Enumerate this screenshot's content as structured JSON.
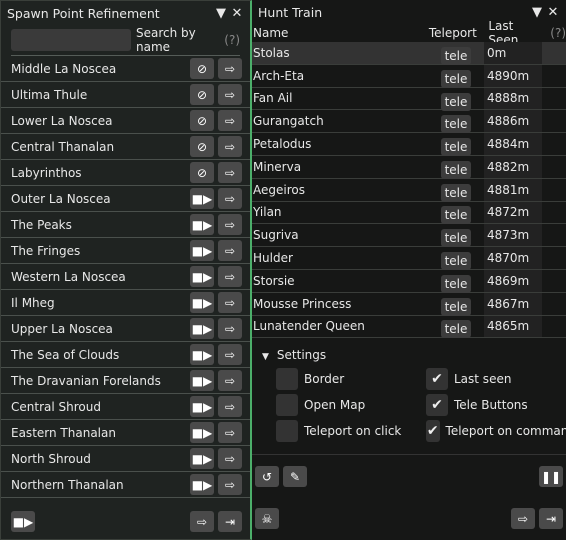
{
  "spawn": {
    "title": "Spawn Point Refinement",
    "search_placeholder": "",
    "search_label": "Search by name",
    "help": "(?)",
    "zones": [
      {
        "name": "Middle La Noscea",
        "disabled": true
      },
      {
        "name": "Ultima Thule",
        "disabled": true
      },
      {
        "name": "Lower La Noscea",
        "disabled": true
      },
      {
        "name": "Central Thanalan",
        "disabled": true
      },
      {
        "name": "Labyrinthos",
        "disabled": true
      },
      {
        "name": "Outer La Noscea",
        "disabled": false
      },
      {
        "name": "The Peaks",
        "disabled": false
      },
      {
        "name": "The Fringes",
        "disabled": false
      },
      {
        "name": "Western La Noscea",
        "disabled": false
      },
      {
        "name": "Il Mheg",
        "disabled": false
      },
      {
        "name": "Upper La Noscea",
        "disabled": false
      },
      {
        "name": "The Sea of Clouds",
        "disabled": false
      },
      {
        "name": "The Dravanian Forelands",
        "disabled": false
      },
      {
        "name": "Central Shroud",
        "disabled": false
      },
      {
        "name": "Eastern Thanalan",
        "disabled": false
      },
      {
        "name": "North Shroud",
        "disabled": false
      },
      {
        "name": "Northern Thanalan",
        "disabled": false
      }
    ]
  },
  "hunt": {
    "title": "Hunt Train",
    "col_name": "Name",
    "col_teleport": "Teleport",
    "col_last": "Last Seen",
    "help": "(?)",
    "tele": "tele",
    "rows": [
      [
        "Stolas",
        "0m"
      ],
      [
        "Arch-Eta",
        "4890m"
      ],
      [
        "Fan Ail",
        "4888m"
      ],
      [
        "Gurangatch",
        "4886m"
      ],
      [
        "Petalodus",
        "4884m"
      ],
      [
        "Minerva",
        "4882m"
      ],
      [
        "Aegeiros",
        "4881m"
      ],
      [
        "Yilan",
        "4872m"
      ],
      [
        "Sugriva",
        "4873m"
      ],
      [
        "Hulder",
        "4870m"
      ],
      [
        "Storsie",
        "4869m"
      ],
      [
        "Mousse Princess",
        "4867m"
      ],
      [
        "Lunatender Queen",
        "4865m"
      ]
    ],
    "settings_label": "Settings",
    "options": [
      {
        "label": "Border",
        "checked": false
      },
      {
        "label": "Last seen",
        "checked": true
      },
      {
        "label": "Open Map",
        "checked": false
      },
      {
        "label": "Tele Buttons",
        "checked": true
      },
      {
        "label": "Teleport on click",
        "checked": false
      },
      {
        "label": "Teleport on command",
        "checked": true
      }
    ]
  },
  "accent": "#4caf6a"
}
